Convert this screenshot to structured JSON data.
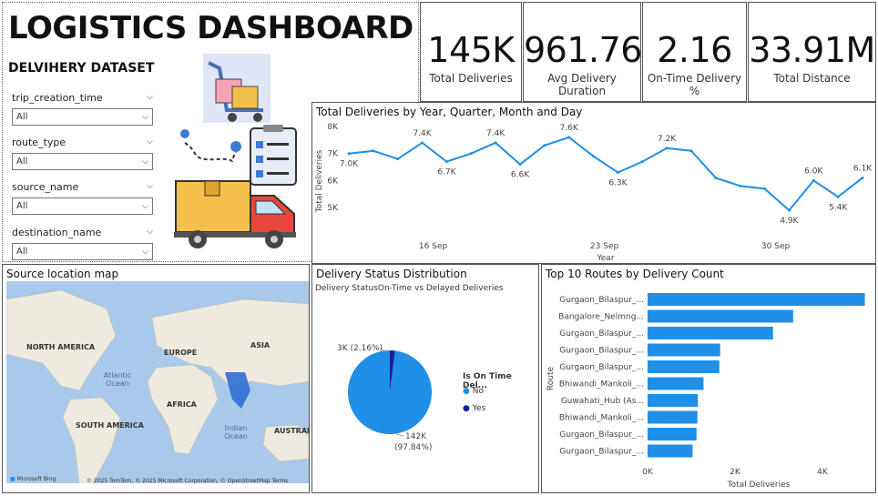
{
  "header": {
    "title": "LOGISTICS DASHBOARD",
    "subtitle": "DELVIHERY DATASET"
  },
  "slicers": [
    {
      "label": "trip_creation_time",
      "value": "All"
    },
    {
      "label": "route_type",
      "value": "All"
    },
    {
      "label": "source_name",
      "value": "All"
    },
    {
      "label": "destination_name",
      "value": "All"
    }
  ],
  "kpis": [
    {
      "value": "145K",
      "label": "Total Deliveries"
    },
    {
      "value": "961.76",
      "label": "Avg Delivery Duration"
    },
    {
      "value": "2.16",
      "label": "On-Time Delivery %"
    },
    {
      "value": "33.91M",
      "label": "Total Distance"
    }
  ],
  "map": {
    "title": "Source location map",
    "labels": [
      "NORTH AMERICA",
      "EUROPE",
      "ASIA",
      "Atlantic Ocean",
      "AFRICA",
      "SOUTH AMERICA",
      "Indian Ocean",
      "AUSTRAL"
    ],
    "attribution": "© 2025 TomTom, © 2025 Microsoft Corporation, © OpenStreetMap  Terms",
    "bing": "Microsoft Bing"
  },
  "chart_data": [
    {
      "type": "line",
      "title": "Total Deliveries by Year, Quarter, Month and Day",
      "xlabel": "Year",
      "ylabel": "Total Deliveries",
      "ylim": [
        4500,
        8000
      ],
      "yticks": [
        "8K",
        "7K",
        "6K",
        "5K"
      ],
      "xticks": [
        "16 Sep",
        "23 Sep",
        "30 Sep"
      ],
      "color": "#1f8fe8",
      "values": [
        7000,
        7100,
        6800,
        7400,
        6700,
        7000,
        7400,
        6600,
        7300,
        7600,
        6900,
        6300,
        6700,
        7200,
        7100,
        6100,
        5800,
        5700,
        4900,
        6000,
        5400,
        6100
      ],
      "data_labels": [
        {
          "i": 0,
          "text": "7.0K"
        },
        {
          "i": 3,
          "text": "7.4K"
        },
        {
          "i": 4,
          "text": "6.7K"
        },
        {
          "i": 6,
          "text": "7.4K"
        },
        {
          "i": 7,
          "text": "6.6K"
        },
        {
          "i": 9,
          "text": "7.6K"
        },
        {
          "i": 11,
          "text": "6.3K"
        },
        {
          "i": 13,
          "text": "7.2K"
        },
        {
          "i": 18,
          "text": "4.9K"
        },
        {
          "i": 19,
          "text": "6.0K"
        },
        {
          "i": 20,
          "text": "5.4K"
        },
        {
          "i": 21,
          "text": "6.1K"
        }
      ]
    },
    {
      "type": "pie",
      "title": "Delivery Status Distribution",
      "subtitle": "Delivery StatusOn-Time vs Delayed Deliveries",
      "legend_title": "Is On Time Del...",
      "slices": [
        {
          "name": "No",
          "value": 142,
          "label": "142K (97.84%)",
          "color": "#1f8fe8"
        },
        {
          "name": "Yes",
          "value": 3,
          "label": "3K (2.16%)",
          "color": "#12239e"
        }
      ]
    },
    {
      "type": "bar",
      "orientation": "horizontal",
      "title": "Top 10 Routes by Delivery Count",
      "xlabel": "Total Deliveries",
      "ylabel": "Route",
      "xlim": [
        0,
        5000
      ],
      "xticks": [
        "0K",
        "2K",
        "4K"
      ],
      "color": "#1f8fe8",
      "categories": [
        "Gurgaon_Bilaspur_...",
        "Bangalore_Nelmng...",
        "Gurgaon_Bilaspur_...",
        "Gurgaon_Bilaspur_...",
        "Gurgaon_Bilaspur_...",
        "Bhiwandi_Mankoli_...",
        "Guwahati_Hub (As...",
        "Bhiwandi_Mankoli_...",
        "Gurgaon_Bilaspur_...",
        "Gurgaon_Bilaspur_..."
      ],
      "values": [
        4970,
        3330,
        2870,
        1660,
        1640,
        1280,
        1150,
        1140,
        1120,
        1030
      ]
    }
  ]
}
